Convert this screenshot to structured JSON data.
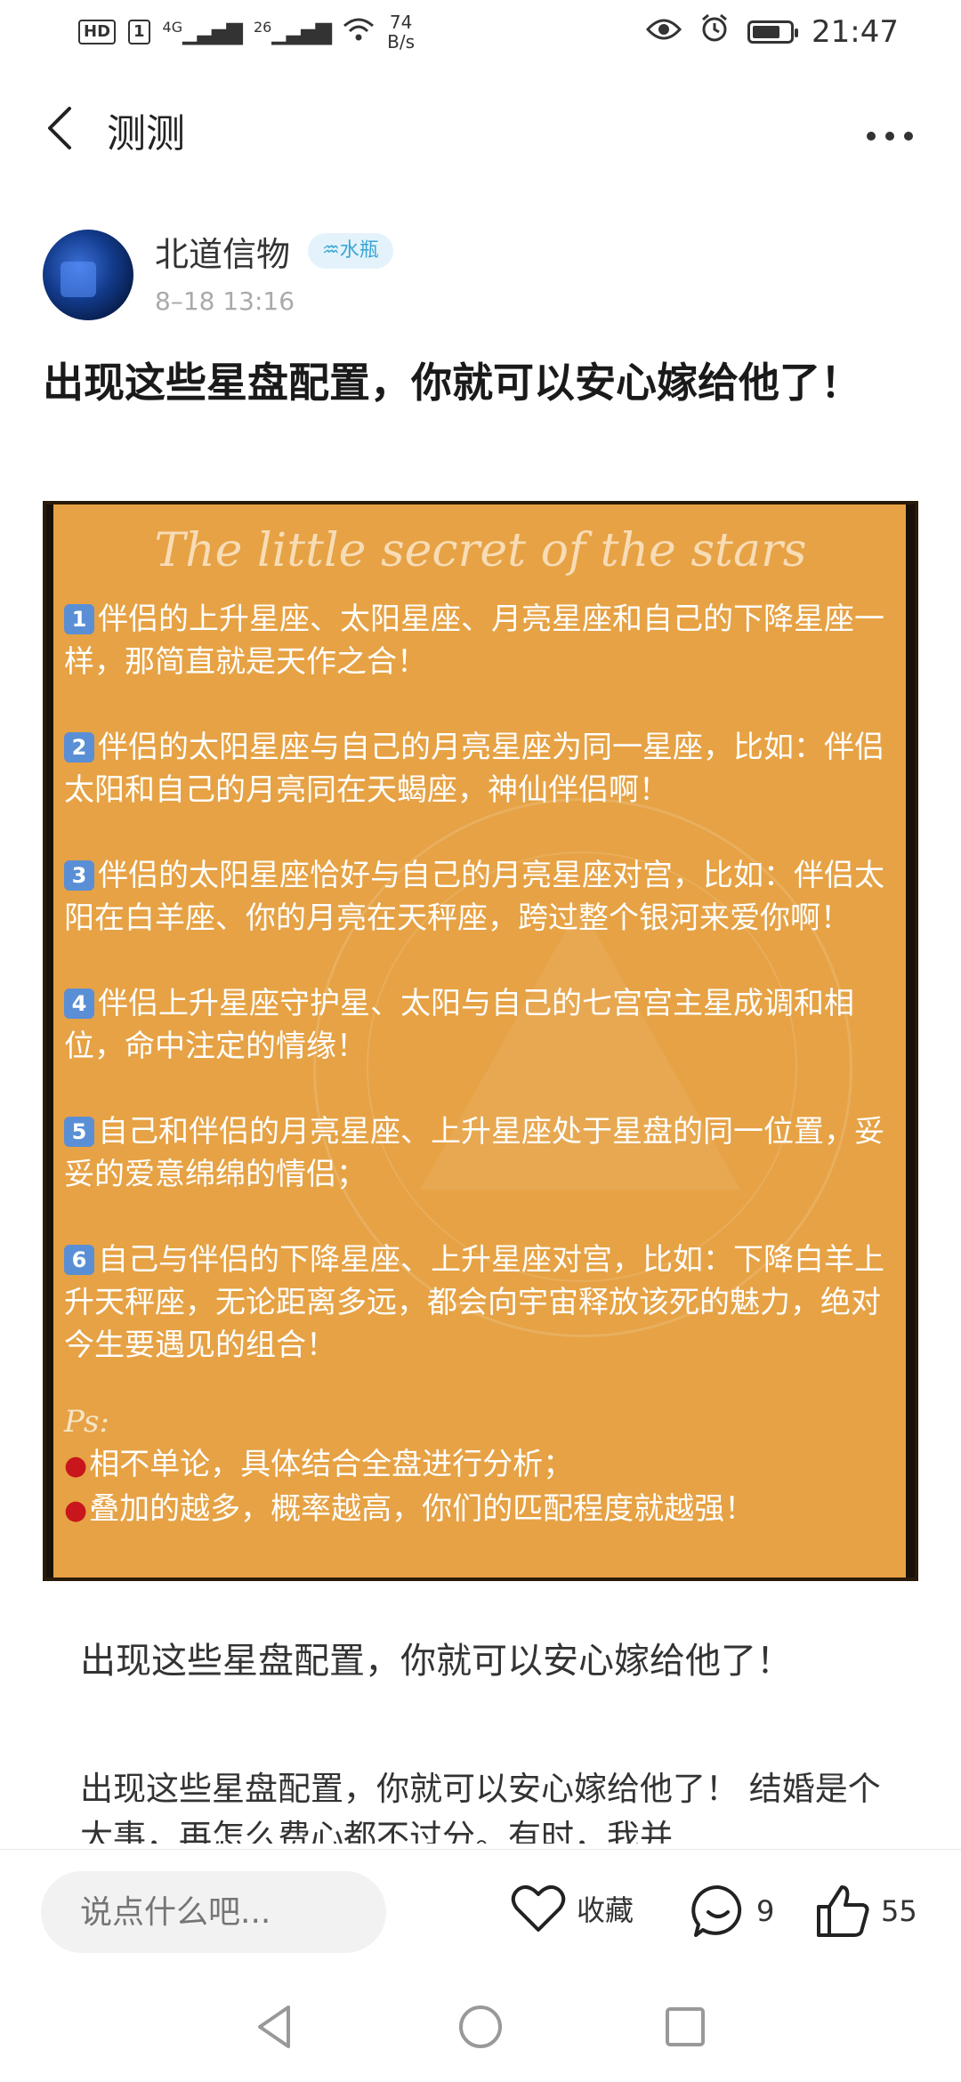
{
  "status_bar": {
    "hd": "HD",
    "sim1": "1",
    "net1": "4G",
    "net2": "26",
    "speed_value": "74",
    "speed_unit": "B/s",
    "time": "21:47"
  },
  "header": {
    "title": "测测"
  },
  "post": {
    "author": "北道信物",
    "badge": "♒水瓶",
    "time": "8–18 13:16",
    "title": "出现这些星盘配置，你就可以安心嫁给他了！",
    "image": {
      "heading": "The little secret of the stars",
      "items": [
        {
          "num": "1",
          "text": "伴侣的上升星座、太阳星座、月亮星座和自己的下降星座一样，那简直就是天作之合！"
        },
        {
          "num": "2",
          "text": "伴侣的太阳星座与自己的月亮星座为同一星座，比如：伴侣太阳和自己的月亮同在天蝎座，神仙伴侣啊！"
        },
        {
          "num": "3",
          "text": "伴侣的太阳星座恰好与自己的月亮星座对宫，比如：伴侣太阳在白羊座、你的月亮在天秤座，跨过整个银河来爱你啊！"
        },
        {
          "num": "4",
          "text": "伴侣上升星座守护星、太阳与自己的七宫宫主星成调和相位，命中注定的情缘！"
        },
        {
          "num": "5",
          "text": "自己和伴侣的月亮星座、上升星座处于星盘的同一位置，妥妥的爱意绵绵的情侣；"
        },
        {
          "num": "6",
          "text": "自己与伴侣的下降星座、上升星座对宫，比如：下降白羊上升天秤座，无论距离多远，都会向宇宙释放该死的魅力，绝对今生要遇见的组合！"
        }
      ],
      "ps_label": "Ps:",
      "ps_lines": [
        "相不单论，具体结合全盘进行分析；",
        "叠加的越多，概率越高，你们的匹配程度就越强！"
      ]
    },
    "subtitle": "出现这些星盘配置，你就可以安心嫁给他了！",
    "excerpt": "出现这些星盘配置，你就可以安心嫁给他了！ 结婚是个大事，再怎么费心都不过分。有时，我并"
  },
  "action_bar": {
    "comment_placeholder": "说点什么吧...",
    "favorite_label": "收藏",
    "comment_count": "9",
    "like_count": "55"
  },
  "colors": {
    "poster_bg": "#e6a244",
    "badge_bg": "#e4f3fb",
    "badge_text": "#3aa6d6"
  },
  "battery_level": 0.75
}
